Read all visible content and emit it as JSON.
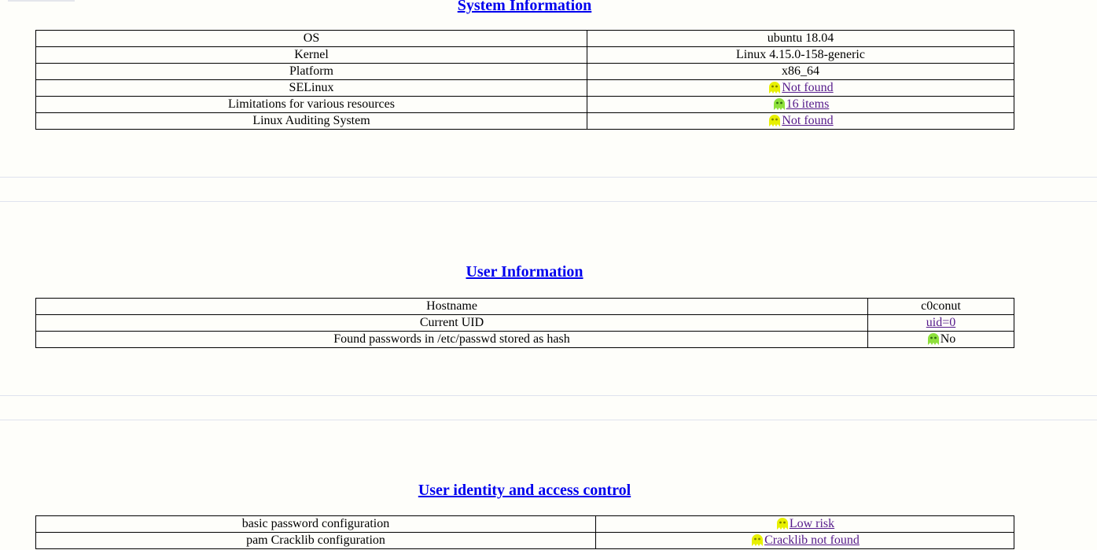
{
  "sections": {
    "system": {
      "title": "System Information",
      "rows": [
        {
          "label": "OS",
          "value": "ubuntu 18.04"
        },
        {
          "label": "Kernel",
          "value": "Linux 4.15.0-158-generic"
        },
        {
          "label": "Platform",
          "value": "x86_64"
        },
        {
          "label": "SELinux",
          "value": "Not found",
          "icon": "yellow-ghost-icon"
        },
        {
          "label": "Limitations for various resources",
          "value": "16 items",
          "icon": "green-ghost-icon"
        },
        {
          "label": "Linux Auditing System",
          "value": "Not found",
          "icon": "yellow-ghost-icon"
        }
      ]
    },
    "user": {
      "title": "User Information",
      "rows": [
        {
          "label": "Hostname",
          "value": "c0conut"
        },
        {
          "label": "Current UID",
          "value": "uid=0"
        },
        {
          "label": "Found passwords in /etc/passwd stored as hash",
          "value": "No",
          "icon": "green-ghost-icon"
        }
      ]
    },
    "identity": {
      "title": "User identity and access control",
      "rows": [
        {
          "label": "basic password configuration",
          "value": "Low risk",
          "icon": "yellow-ghost-icon"
        },
        {
          "label": "pam Cracklib configuration",
          "value": "Cracklib not found",
          "icon": "yellow-ghost-icon"
        }
      ]
    }
  },
  "colors": {
    "heading_link": "#0000ee",
    "visited_link": "#551a8b",
    "ghost_yellow": "#e8f000",
    "ghost_green": "#8ee03c"
  }
}
